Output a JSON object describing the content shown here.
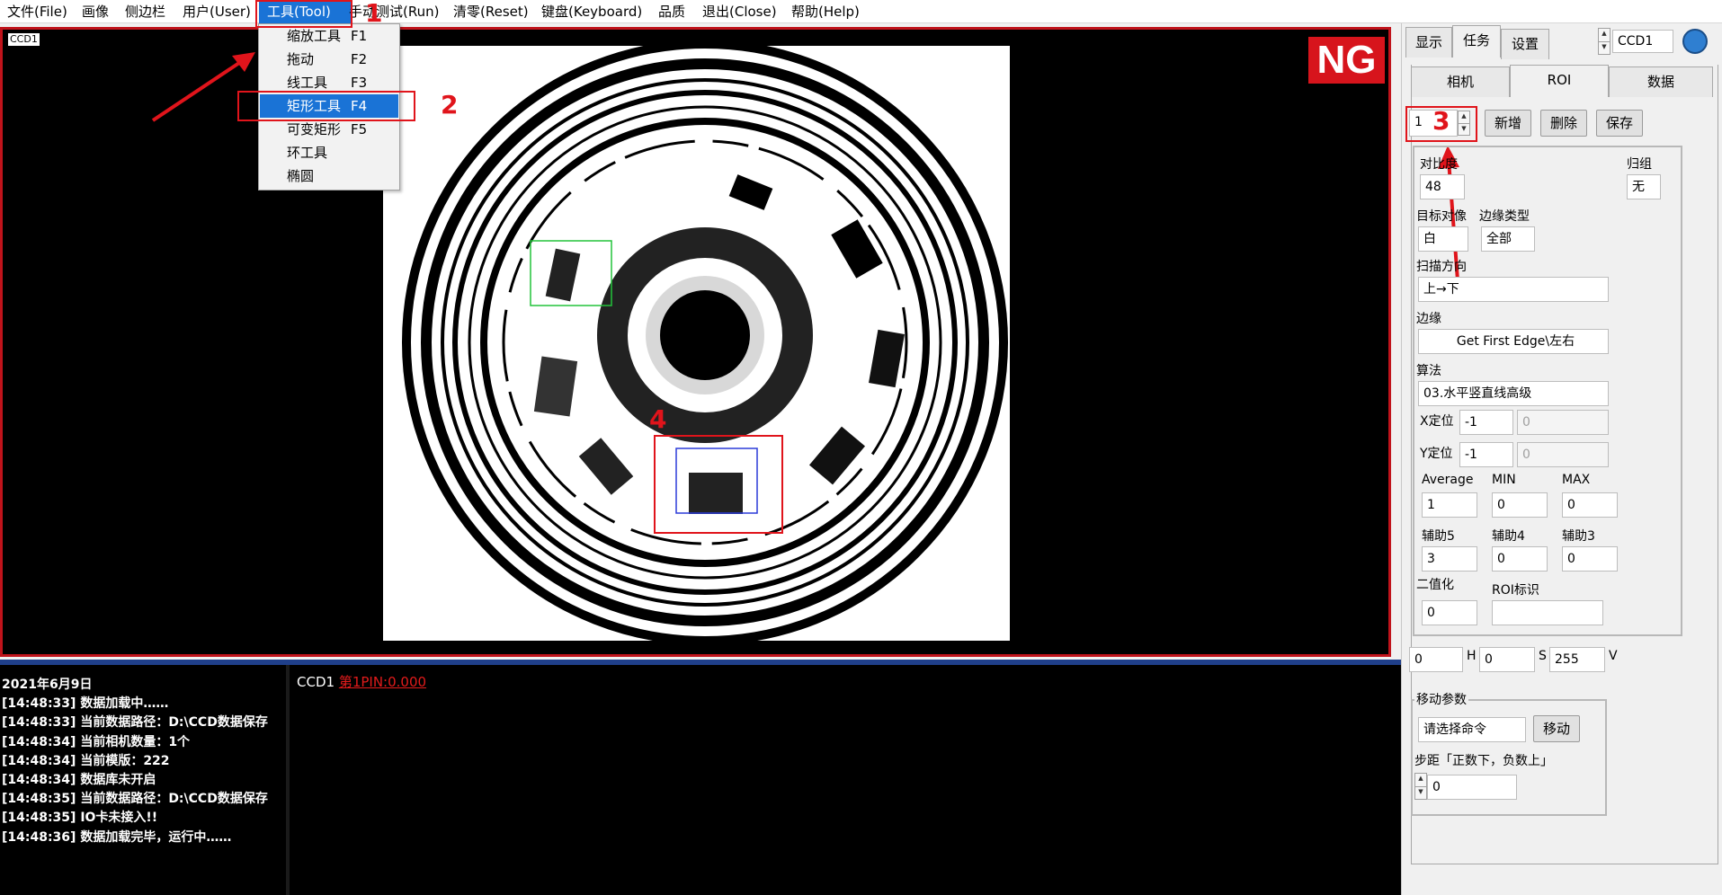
{
  "menu": {
    "items": [
      {
        "label": "文件(File)"
      },
      {
        "label": "画像"
      },
      {
        "label": "侧边栏"
      },
      {
        "label": "用户(User)"
      },
      {
        "label": "工具(Tool)"
      },
      {
        "label": "手动测试(Run)"
      },
      {
        "label": "清零(Reset)"
      },
      {
        "label": "键盘(Keyboard)"
      },
      {
        "label": "品质"
      },
      {
        "label": "退出(Close)"
      },
      {
        "label": "帮助(Help)"
      }
    ],
    "tool_dropdown": [
      {
        "label": "缩放工具",
        "key": "F1"
      },
      {
        "label": "拖动",
        "key": "F2"
      },
      {
        "label": "线工具",
        "key": "F3"
      },
      {
        "label": "矩形工具",
        "key": "F4"
      },
      {
        "label": "可变矩形",
        "key": "F5"
      },
      {
        "label": "环工具",
        "key": ""
      },
      {
        "label": "椭圆",
        "key": ""
      }
    ]
  },
  "annotations": {
    "n1": "1",
    "n2": "2",
    "n3": "3",
    "n4": "4"
  },
  "viewer": {
    "camera_tag": "CCD1",
    "result": "NG"
  },
  "log": {
    "date": "2021年6月9日",
    "lines": [
      "[14:48:33]  数据加载中……",
      "[14:48:33]  当前数据路径：D:\\CCD数据保存",
      "[14:48:34]  当前相机数量：1个",
      "[14:48:34]  当前模版：222",
      "[14:48:34]  数据库未开启",
      "[14:48:35]  当前数据路径：D:\\CCD数据保存",
      "[14:48:35]  IO卡未接入!!",
      "[14:48:36]  数据加载完毕，运行中……"
    ],
    "camera": "CCD1",
    "pin_result": "第1PIN:0.000"
  },
  "panel": {
    "top_tabs": [
      "显示",
      "任务",
      "设置"
    ],
    "camera_select": "CCD1",
    "sub_tabs": [
      "相机",
      "ROI",
      "数据"
    ],
    "roi_index": "1",
    "buttons": {
      "add": "新增",
      "delete": "删除",
      "save": "保存"
    },
    "contrast_label": "对比度",
    "contrast_value": "48",
    "group_label": "归组",
    "group_value": "无",
    "target_label": "目标对像",
    "target_value": "白",
    "edge_type_label": "边缘类型",
    "edge_type_value": "全部",
    "scan_dir_label": "扫描方向",
    "scan_dir_value": "上→下",
    "edge_label": "边缘",
    "edge_value": "Get First Edge\\左右",
    "algo_label": "算法",
    "algo_value": "03.水平竖直线高级",
    "x_pos_label": "X定位",
    "x_pos_value": "-1",
    "x_pos_value2": "0",
    "y_pos_label": "Y定位",
    "y_pos_value": "-1",
    "y_pos_value2": "0",
    "average_label": "Average",
    "average_value": "1",
    "min_label": "MIN",
    "min_value": "0",
    "max_label": "MAX",
    "max_value": "0",
    "aux5_label": "辅助5",
    "aux5_value": "3",
    "aux4_label": "辅助4",
    "aux4_value": "0",
    "aux3_label": "辅助3",
    "aux3_value": "0",
    "binarize_label": "二值化",
    "binarize_value": "0",
    "roi_mark_label": "ROI标识",
    "roi_mark_value": "",
    "h_value": "0",
    "h_label": "H",
    "s_value": "0",
    "s_label": "S",
    "v_value": "255",
    "v_label": "V",
    "move_group_label": "移动参数",
    "move_command": "请选择命令",
    "move_button": "移动",
    "step_label": "步距「正数下，负数上」",
    "step_value": "0"
  },
  "colors": {
    "accent": "#1a73d6",
    "annotation_red": "#e0141b",
    "ng_red": "#d7141c"
  }
}
